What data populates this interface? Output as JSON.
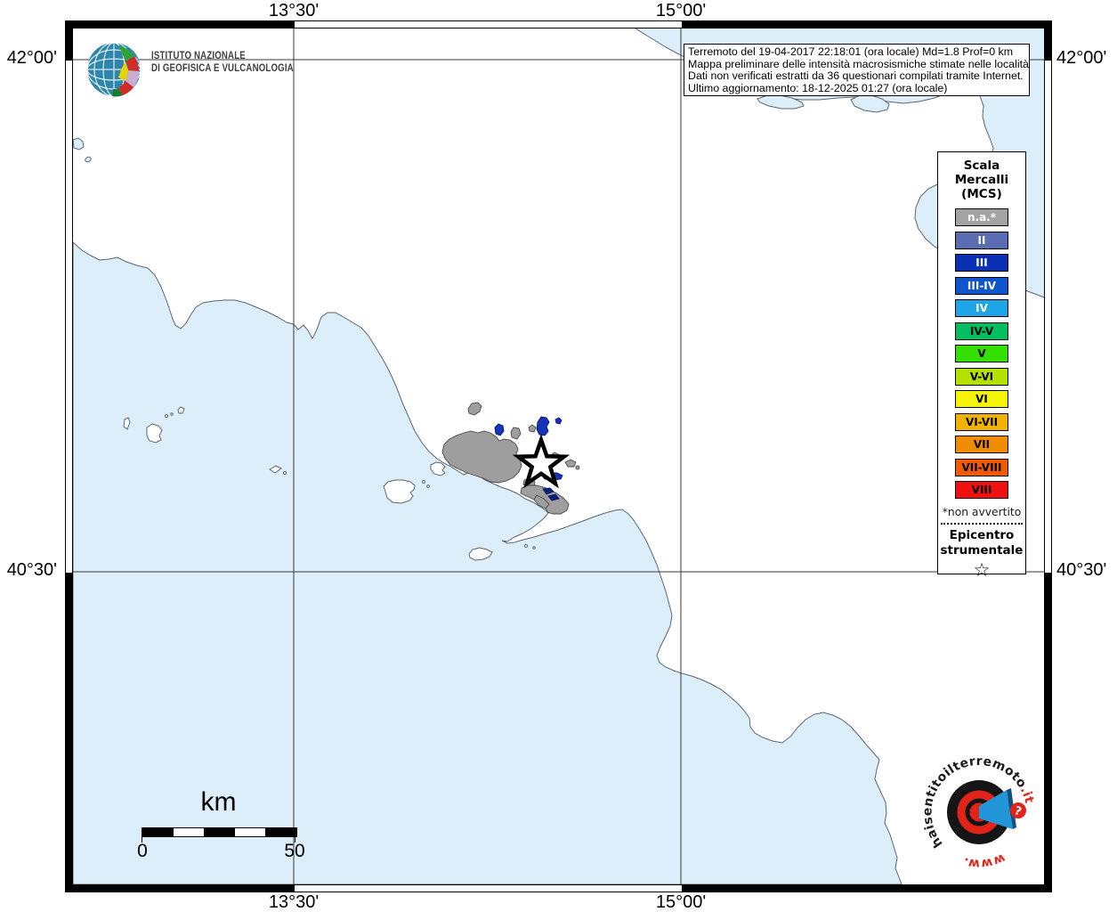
{
  "axes": {
    "top": [
      "13°30'",
      "15°00'"
    ],
    "bottom": [
      "13°30'",
      "15°00'"
    ],
    "left": [
      "42°00'",
      "40°30'"
    ],
    "right": [
      "42°00'",
      "40°30'"
    ]
  },
  "title_box": {
    "lines": [
      "Terremoto del 19-04-2017 22:18:01 (ora locale) Md=1.8 Prof=0 km",
      "Mappa preliminare delle intensità macrosismiche stimate nelle località",
      "Dati non verificati estratti da 36 questionari compilati tramite Internet.",
      "Ultimo aggiornamento: 18-12-2025 01:27 (ora locale)"
    ]
  },
  "ingv_logo": {
    "line1": "ISTITUTO NAZIONALE",
    "line2": "DI GEOFISICA E VULCANOLOGIA"
  },
  "legend": {
    "title_lines": [
      "Scala",
      "Mercalli",
      "(MCS)"
    ],
    "items": [
      {
        "label": "n.a.*",
        "color": "#a3a3a3",
        "text_color": "#ffffff"
      },
      {
        "label": "II",
        "color": "#5a6db3",
        "text_color": "#ffffff"
      },
      {
        "label": "III",
        "color": "#0a30b4",
        "text_color": "#ffffff"
      },
      {
        "label": "III-IV",
        "color": "#0f55cc",
        "text_color": "#ffffff"
      },
      {
        "label": "IV",
        "color": "#1ea5e8",
        "text_color": "#ffffff"
      },
      {
        "label": "IV-V",
        "color": "#00bf60",
        "text_color": "#000000"
      },
      {
        "label": "V",
        "color": "#33e000",
        "text_color": "#000000"
      },
      {
        "label": "V-VI",
        "color": "#b5e000",
        "text_color": "#000000"
      },
      {
        "label": "VI",
        "color": "#f5f500",
        "text_color": "#000000"
      },
      {
        "label": "VI-VII",
        "color": "#f0b400",
        "text_color": "#000000"
      },
      {
        "label": "VII",
        "color": "#f08c00",
        "text_color": "#000000"
      },
      {
        "label": "VII-VIII",
        "color": "#f05a00",
        "text_color": "#000000"
      },
      {
        "label": "VIII",
        "color": "#f01010",
        "text_color": "#000000"
      }
    ],
    "footnote": "*non avvertito",
    "epicenter_lines": [
      "Epicentro",
      "strumentale"
    ],
    "epicenter_symbol": "☆"
  },
  "scale_bar": {
    "unit": "km",
    "start_label": "0",
    "end_label": "50"
  },
  "watermark": {
    "arc_text_black": "haisentitoilterremoto",
    "arc_text_red": ".it",
    "bottom_text": "www.",
    "question_mark": "?"
  },
  "map_colors": {
    "sea": "#dceefa",
    "land": "#ffffff",
    "coastline": "#5c6670",
    "gridline": "#3a3a3a",
    "locality_not_classified": "#9e9e9e",
    "locality_intensity_blue": "#1533bb",
    "epicenter_fill": "#ffffff",
    "epicenter_stroke": "#000000",
    "watermark_red": "#e2231a",
    "watermark_blue": "#2196d8"
  }
}
